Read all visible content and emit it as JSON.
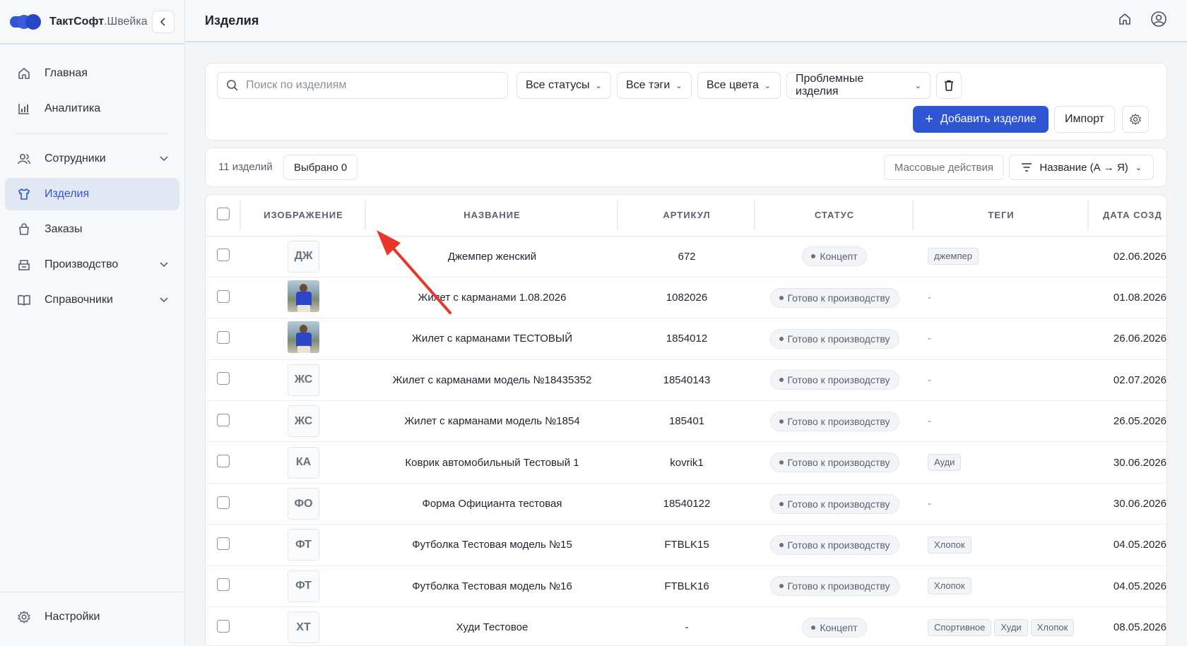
{
  "brand": {
    "name": "ТактСофт",
    "suffix": ".Швейка"
  },
  "sidebar": {
    "items": [
      {
        "label": "Главная",
        "icon": "home-icon"
      },
      {
        "label": "Аналитика",
        "icon": "chart-icon"
      },
      {
        "label": "Сотрудники",
        "icon": "users-icon",
        "expandable": true
      },
      {
        "label": "Изделия",
        "icon": "shirt-icon",
        "active": true
      },
      {
        "label": "Заказы",
        "icon": "bag-icon"
      },
      {
        "label": "Производство",
        "icon": "factory-icon",
        "expandable": true
      },
      {
        "label": "Справочники",
        "icon": "book-icon",
        "expandable": true
      }
    ],
    "settings_label": "Настройки"
  },
  "header": {
    "title": "Изделия"
  },
  "filters": {
    "search_placeholder": "Поиск по изделиям",
    "status": "Все статусы",
    "tags": "Все тэги",
    "colors": "Все цвета",
    "problem": "Проблемные изделия",
    "add_label": "Добавить изделие",
    "import_label": "Импорт"
  },
  "toolbar": {
    "count": "11 изделий",
    "selected": "Выбрано 0",
    "mass_actions": "Массовые действия",
    "sort": "Название (А → Я)"
  },
  "table": {
    "headers": {
      "image": "Изображение",
      "name": "Название",
      "sku": "Артикул",
      "status": "Статус",
      "tags": "Теги",
      "date": "Дата созд"
    },
    "rows": [
      {
        "initials": "ДЖ",
        "name": "Джемпер женский",
        "sku": "672",
        "status": "Концепт",
        "tags": [
          "джемпер"
        ],
        "date": "02.06.2026"
      },
      {
        "photo": true,
        "name": "Жилет с карманами 1.08.2026",
        "sku": "1082026",
        "status": "Готово к производству",
        "tags": [],
        "date": "01.08.2026"
      },
      {
        "photo": true,
        "name": "Жилет с карманами ТЕСТОВЫЙ",
        "sku": "1854012",
        "status": "Готово к производству",
        "tags": [],
        "date": "26.06.2026"
      },
      {
        "initials": "ЖС",
        "name": "Жилет с карманами модель №18435352",
        "sku": "18540143",
        "status": "Готово к производству",
        "tags": [],
        "date": "02.07.2026"
      },
      {
        "initials": "ЖС",
        "name": "Жилет с карманами модель №1854",
        "sku": "185401",
        "status": "Готово к производству",
        "tags": [],
        "date": "26.05.2026"
      },
      {
        "initials": "КА",
        "name": "Коврик автомобильный Тестовый 1",
        "sku": "kovrik1",
        "status": "Готово к производству",
        "tags": [
          "Ауди"
        ],
        "date": "30.06.2026"
      },
      {
        "initials": "ФО",
        "name": "Форма Официанта тестовая",
        "sku": "18540122",
        "status": "Готово к производству",
        "tags": [],
        "date": "30.06.2026"
      },
      {
        "initials": "ФТ",
        "name": "Футболка Тестовая модель №15",
        "sku": "FTBLK15",
        "status": "Готово к производству",
        "tags": [
          "Хлопок"
        ],
        "date": "04.05.2026"
      },
      {
        "initials": "ФТ",
        "name": "Футболка Тестовая модель №16",
        "sku": "FTBLK16",
        "status": "Готово к производству",
        "tags": [
          "Хлопок"
        ],
        "date": "04.05.2026"
      },
      {
        "initials": "ХТ",
        "name": "Худи Тестовое",
        "sku": "-",
        "status": "Концепт",
        "tags": [
          "Спортивное",
          "Худи",
          "Хлопок"
        ],
        "date": "08.05.2026"
      }
    ],
    "empty_tag": "-"
  },
  "colors": {
    "accent": "#2f55d4",
    "annotation_arrow": "#e8362b"
  }
}
